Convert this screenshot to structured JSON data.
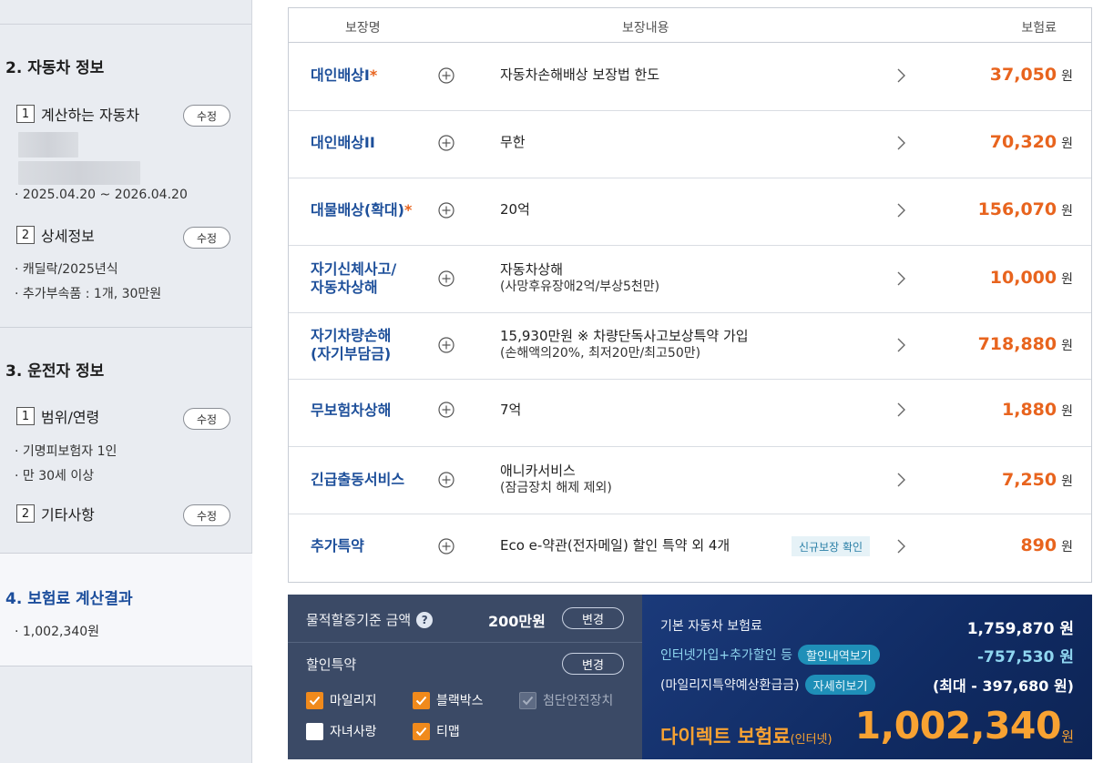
{
  "sidebar": {
    "car_info": {
      "title": "2. 자동차 정보",
      "items": [
        {
          "num": "1",
          "label": "계산하는 자동차",
          "edit": "수정"
        },
        {
          "num": "2",
          "label": "상세정보",
          "edit": "수정"
        }
      ],
      "period": "· 2025.04.20 ~ 2026.04.20",
      "detail_lines": [
        "· 캐딜락/2025년식",
        "· 추가부속품 : 1개, 30만원"
      ]
    },
    "driver_info": {
      "title": "3. 운전자 정보",
      "items": [
        {
          "num": "1",
          "label": "범위/연령",
          "edit": "수정"
        },
        {
          "num": "2",
          "label": "기타사항",
          "edit": "수정"
        }
      ],
      "range_lines": [
        "· 기명피보험자 1인",
        "· 만 30세 이상"
      ]
    },
    "result": {
      "title": "4. 보험료 계산결과",
      "amount": "· 1,002,340원"
    }
  },
  "table": {
    "headers": {
      "name": "보장명",
      "content": "보장내용",
      "premium": "보험료"
    },
    "rows": [
      {
        "name": "대인배상I",
        "star": "*",
        "desc": "자동차손해배상 보장법 한도",
        "sub": "",
        "premium": "37,050",
        "won": "원"
      },
      {
        "name": "대인배상II",
        "star": "",
        "desc": "무한",
        "sub": "",
        "premium": "70,320",
        "won": "원"
      },
      {
        "name": "대물배상(확대)",
        "star": "*",
        "desc": "20억",
        "sub": "",
        "premium": "156,070",
        "won": "원"
      },
      {
        "name": "자기신체사고/",
        "name2": "자동차상해",
        "star": "",
        "desc": "자동차상해",
        "sub": "(사망후유장애2억/부상5천만)",
        "premium": "10,000",
        "won": "원"
      },
      {
        "name": "자기차량손해",
        "name2": "(자기부담금)",
        "star": "",
        "desc": "15,930만원 ※ 차량단독사고보상특약 가입",
        "sub": "(손해액의20%, 최저20만/최고50만)",
        "premium": "718,880",
        "won": "원"
      },
      {
        "name": "무보험차상해",
        "star": "",
        "desc": "7억",
        "sub": "",
        "premium": "1,880",
        "won": "원"
      },
      {
        "name": "긴급출동서비스",
        "star": "",
        "desc": "애니카서비스",
        "sub": "(잠금장치 해제 제외)",
        "premium": "7,250",
        "won": "원"
      },
      {
        "name": "추가특약",
        "star": "",
        "desc": "Eco e-약관(전자메일) 할인 특약 외 4개",
        "sub": "",
        "badge": "신규보장 확인",
        "premium": "890",
        "won": "원"
      }
    ]
  },
  "discount_panel": {
    "property_label": "물적할증기준 금액",
    "property_amount": "200만원",
    "change": "변경",
    "discount_label": "할인특약",
    "options": [
      {
        "label": "마일리지",
        "state": "checked"
      },
      {
        "label": "블랙박스",
        "state": "checked"
      },
      {
        "label": "첨단안전장치",
        "state": "disabled"
      },
      {
        "label": "자녀사랑",
        "state": "empty"
      },
      {
        "label": "티맵",
        "state": "checked"
      }
    ]
  },
  "summary": {
    "base_label": "기본 자동차 보험료",
    "base_value": "1,759,870 원",
    "discount_label": "인터넷가입+추가할인 등",
    "discount_btn": "할인내역보기",
    "discount_value": "-757,530 원",
    "mileage_label": "(마일리지특약예상환급금)",
    "mileage_btn": "자세히보기",
    "mileage_value": "(최대 - 397,680 원)",
    "total_label": "다이렉트 보험료",
    "total_label_small": "(인터넷)",
    "total_value": "1,002,340",
    "total_won": "원"
  },
  "colors": {
    "accent_orange": "#e8641e",
    "navy": "#1d4f9a",
    "panel_dark": "#3b4a66",
    "panel_blue": "#102b63"
  }
}
